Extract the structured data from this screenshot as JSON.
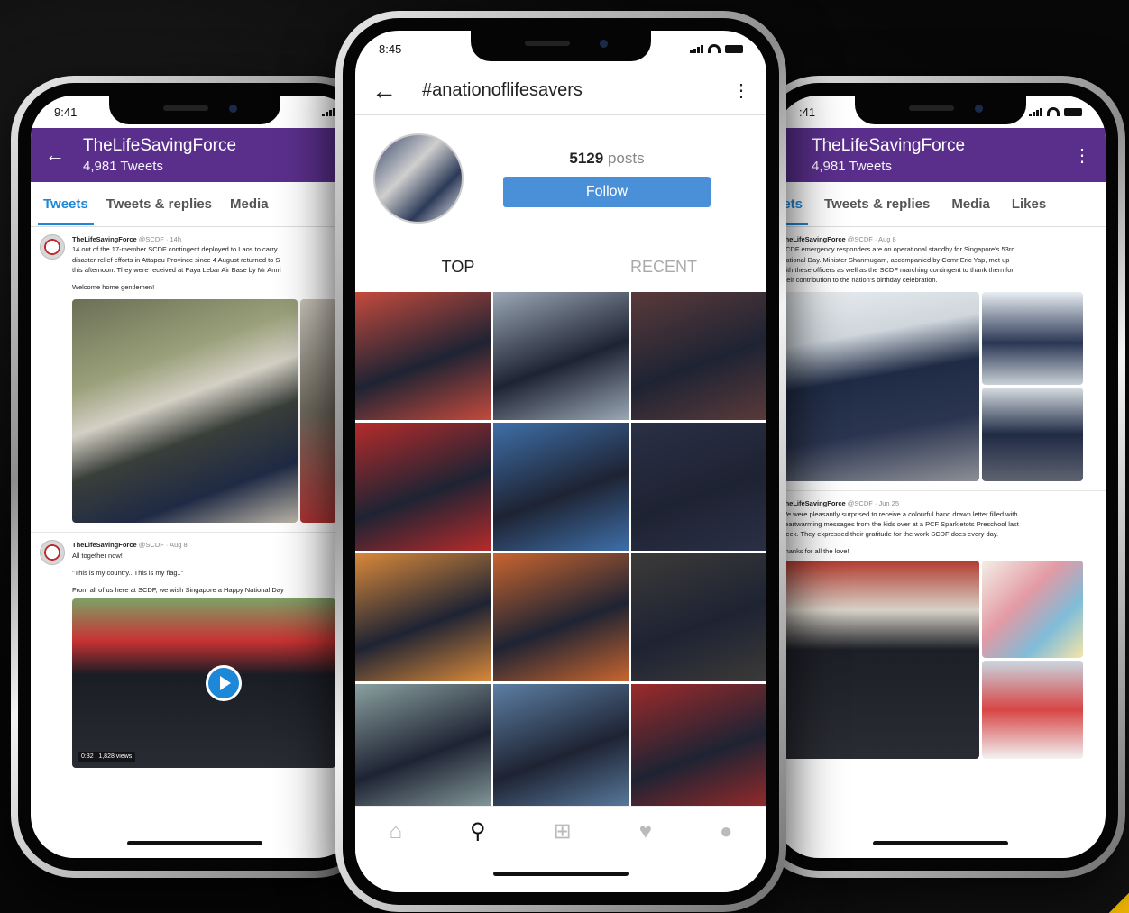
{
  "left_phone": {
    "status_time": "9:41",
    "header": {
      "name": "TheLifeSavingForce",
      "count": "4,981 Tweets"
    },
    "tabs": [
      "Tweets",
      "Tweets & replies",
      "Media"
    ],
    "tweets": [
      {
        "author": "TheLifeSavingForce",
        "meta": "@SCDF · 14h",
        "text_lines": [
          "14 out of the 17-member SCDF contingent deployed to Laos to carry",
          "disaster relief efforts in Attapeu Province since 4 August returned to S",
          "this afternoon. They were received at Paya Lebar Air Base by Mr Amri",
          "",
          "Welcome home gentlemen!"
        ]
      },
      {
        "author": "TheLifeSavingForce",
        "meta": "@SCDF · Aug 8",
        "text_lines": [
          "All together now!",
          "",
          "\"This is my country.. This is my flag..\"",
          "",
          "From all of us here at SCDF, we wish Singapore a Happy National Day"
        ],
        "video_views": "0:32 | 1,828 views"
      }
    ]
  },
  "center_phone": {
    "status_time": "8:45",
    "hashtag": "#anationoflifesavers",
    "posts_count": "5129",
    "posts_label": "posts",
    "follow_label": "Follow",
    "tabs": [
      "TOP",
      "RECENT"
    ],
    "grid_tile_colors": [
      "#c44a3d",
      "#9aa7b5",
      "#5a3a3a",
      "#b52b2b",
      "#3e6fa8",
      "#2a2f45",
      "#d9893a",
      "#c8652f",
      "#3c3a38",
      "#8aa0a0",
      "#5c7fa3",
      "#9c2a2a"
    ]
  },
  "right_phone": {
    "status_time": ":41",
    "header": {
      "name": "TheLifeSavingForce",
      "count": "4,981 Tweets"
    },
    "tabs": [
      "eets",
      "Tweets & replies",
      "Media",
      "Likes"
    ],
    "tweets": [
      {
        "author": "TheLifeSavingForce",
        "meta": "@SCDF · Aug 8",
        "text_lines": [
          "SCDF emergency responders are on operational standby for Singapore's 53rd",
          "National Day. Minister Shanmugam, accompanied by Comr Eric Yap, met up",
          "with these officers as well as the SCDF marching contingent to thank them for",
          "their contribution to the nation's birthday celebration."
        ]
      },
      {
        "author": "TheLifeSavingForce",
        "meta": "@SCDF · Jun 25",
        "text_lines": [
          "We were pleasantly surprised to receive a colourful hand drawn letter filled with",
          "heartwarming messages from the kids over at a PCF Sparkletots Preschool last",
          "week. They expressed their gratitude for the work SCDF does every day.",
          "",
          "Thanks for all the love!"
        ]
      }
    ]
  },
  "colors": {
    "twitter_purple": "#5a2f8c",
    "twitter_blue": "#1d87d8",
    "follow_blue": "#4a90d9"
  },
  "icons": [
    "back-arrow-icon",
    "kebab-icon",
    "home-icon",
    "search-icon",
    "add-icon",
    "heart-icon",
    "profile-icon",
    "play-icon"
  ]
}
